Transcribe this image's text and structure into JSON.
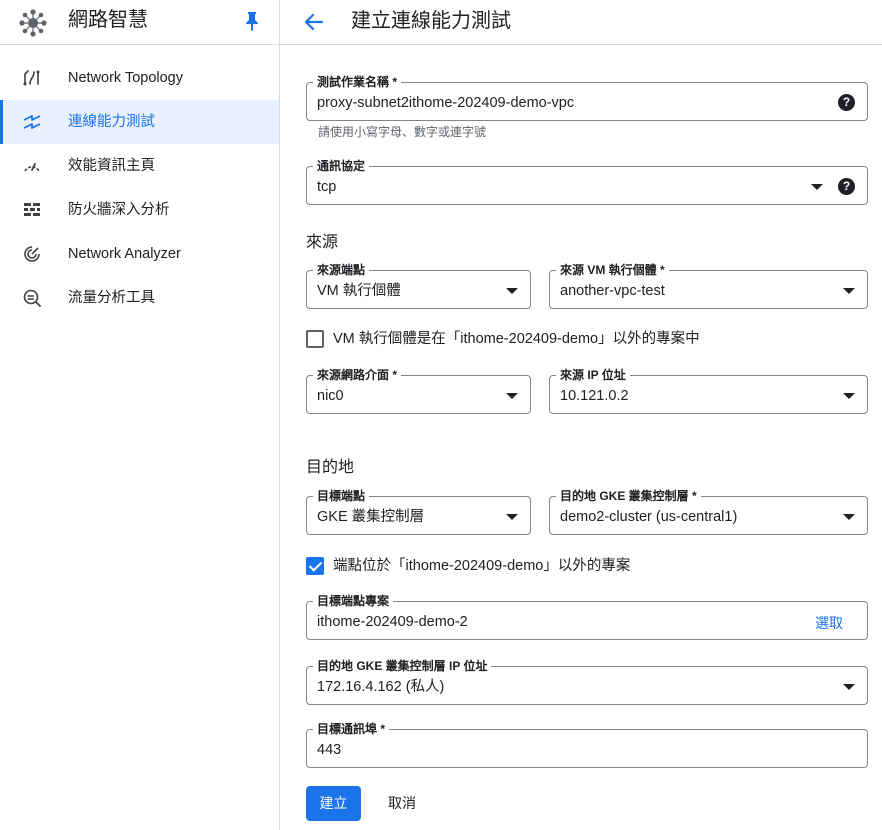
{
  "sidebar": {
    "title": "網路智慧",
    "items": [
      {
        "label": "Network Topology",
        "icon": "topology-icon"
      },
      {
        "label": "連線能力測試",
        "icon": "connectivity-icon"
      },
      {
        "label": "效能資訊主頁",
        "icon": "speedometer-icon"
      },
      {
        "label": "防火牆深入分析",
        "icon": "firewall-icon"
      },
      {
        "label": "Network Analyzer",
        "icon": "analyzer-icon"
      },
      {
        "label": "流量分析工具",
        "icon": "traffic-analysis-icon"
      }
    ],
    "active_index": 1
  },
  "header": {
    "title": "建立連線能力測試"
  },
  "form": {
    "test_name": {
      "label": "測試作業名稱 *",
      "value": "proxy-subnet2ithome-202409-demo-vpc",
      "hint": "請使用小寫字母、數字或連字號"
    },
    "protocol": {
      "label": "通訊協定",
      "value": "tcp"
    },
    "source": {
      "heading": "來源",
      "endpoint": {
        "label": "來源端點",
        "value": "VM 執行個體"
      },
      "vm_instance": {
        "label": "來源 VM 執行個體 *",
        "value": "another-vpc-test"
      },
      "other_project_checkbox": {
        "label": "VM 執行個體是在「ithome-202409-demo」以外的專案中",
        "checked": false
      },
      "network_interface": {
        "label": "來源網路介面 *",
        "value": "nic0"
      },
      "ip": {
        "label": "來源 IP 位址",
        "value": "10.121.0.2"
      }
    },
    "destination": {
      "heading": "目的地",
      "endpoint": {
        "label": "目標端點",
        "value": "GKE 叢集控制層"
      },
      "gke_control_plane": {
        "label": "目的地 GKE 叢集控制層 *",
        "value": "demo2-cluster (us-central1)"
      },
      "other_project_checkbox": {
        "label": "端點位於「ithome-202409-demo」以外的專案",
        "checked": true
      },
      "project": {
        "label": "目標端點專案",
        "value": "ithome-202409-demo-2",
        "action": "選取"
      },
      "gke_ip": {
        "label": "目的地 GKE 叢集控制層 IP 位址",
        "value": "172.16.4.162 (私人)"
      },
      "port": {
        "label": "目標通訊埠 *",
        "value": "443"
      }
    }
  },
  "buttons": {
    "create": "建立",
    "cancel": "取消"
  },
  "colors": {
    "accent": "#1a73e8",
    "active_bg": "#e8f0fe",
    "border": "#80868b"
  }
}
